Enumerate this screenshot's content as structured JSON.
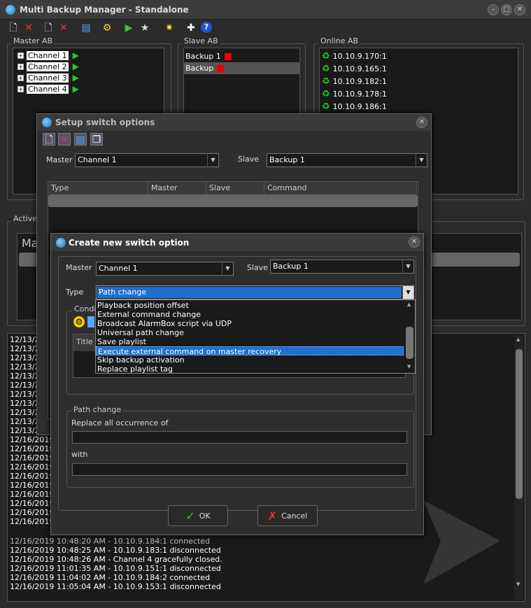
{
  "app": {
    "title": "Multi Backup Manager - Standalone"
  },
  "window_buttons": [
    "–",
    "□",
    "✕"
  ],
  "toolbar": {
    "icons": [
      "new-icon",
      "delete-icon",
      "new-icon",
      "delete-icon",
      "list-icon",
      "settings-icon",
      "play-icon",
      "star-icon",
      "network-icon",
      "add-icon",
      "help-icon"
    ]
  },
  "master_group": {
    "label": "Master AB",
    "channels": [
      "Channel 1",
      "Channel 2",
      "Channel 3",
      "Channel 4"
    ]
  },
  "slave_group": {
    "label": "Slave AB",
    "items": [
      "Backup 1",
      "Backup"
    ]
  },
  "online_group": {
    "label": "Online AB",
    "items": [
      "10.10.9.170:1",
      "10.10.9.165:1",
      "10.10.9.182:1",
      "10.10.9.178:1",
      "10.10.9.186:1"
    ]
  },
  "active_group": {
    "label": "Active",
    "partial": "Ma"
  },
  "setup_dialog": {
    "title": "Setup switch options",
    "master_label": "Master",
    "master_value": "Channel 1",
    "slave_label": "Slave",
    "slave_value": "Backup 1",
    "columns": [
      "Type",
      "Master",
      "Slave",
      "Command"
    ]
  },
  "create_dialog": {
    "title": "Create new switch option",
    "master_label": "Master",
    "master_value": "Channel 1",
    "slave_label": "Slave",
    "slave_value": "Backup 1",
    "type_label": "Type",
    "type_value": "Path change",
    "conditions_label": "Condit",
    "conditions_col": "Title",
    "dropdown_items": [
      "Playback position offset",
      "External command change",
      "Broadcast AlarmBox script via UDP",
      "Universal path change",
      "Save playlist",
      "Execute external command on master recovery",
      "Skip backup activation",
      "Replace playlist tag"
    ],
    "dropdown_selected_index": 5,
    "path_group_label": "Path change",
    "replace_label": "Replace all occurrence of",
    "with_label": "with",
    "ok_label": "OK",
    "cancel_label": "Cancel"
  },
  "log": {
    "left_stubs": [
      "12/13/2",
      "12/13/2",
      "12/13/2",
      "12/13/2",
      "12/13/2",
      "12/13/2",
      "12/13/2",
      "12/13/2",
      "12/13/2",
      "12/13/2",
      "12/13/2"
    ],
    "left_dates": [
      "12/16/2019",
      "12/16/2019",
      "12/16/2019",
      "12/16/2019",
      "12/16/2019",
      "12/16/2019",
      "12/16/2019",
      "12/16/2019",
      "12/16/2019",
      "12/16/2019"
    ],
    "full_lines": [
      "12/16/2019 10:48:25 AM - 10.10.9.183:1 disconnected",
      "12/16/2019 10:48:26 AM - Channel 4 gracefully closed.",
      "12/16/2019 11:01:35 AM - 10.10.9.151:1 disconnected",
      "12/16/2019 11:04:02 AM - 10.10.9.184:2 connected",
      "12/16/2019 11:05:04 AM - 10.10.9.153:1 disconnected"
    ],
    "partial_line": "12/16/2019 10:48:20 AM - 10.10.9.184:1 connected"
  }
}
